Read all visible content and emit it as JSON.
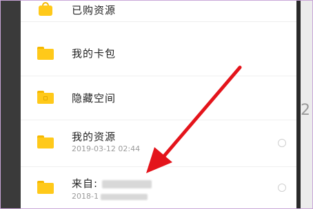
{
  "rows": [
    {
      "title": "已购资源",
      "icon": "shopping-bag-icon"
    },
    {
      "title": "我的卡包",
      "icon": "folder-icon"
    },
    {
      "title": "隐藏空间",
      "icon": "locked-folder-icon"
    },
    {
      "title": "我的资源",
      "date": "2019-03-12  02:44",
      "icon": "folder-icon"
    },
    {
      "title": "来自:",
      "date": "2018-1",
      "icon": "folder-icon"
    }
  ],
  "colors": {
    "folder": "#ffc91a",
    "arrow": "#e4141b"
  }
}
